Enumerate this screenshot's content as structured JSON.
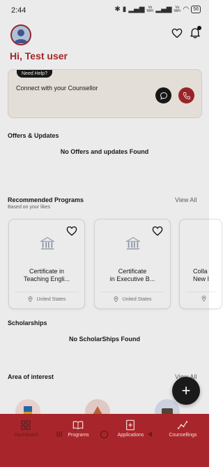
{
  "status_bar": {
    "time": "2:44",
    "battery": "56"
  },
  "header": {
    "greeting": "Hi, Test user"
  },
  "help_card": {
    "badge": "Need Help?",
    "text": "Connect with your Counsellor"
  },
  "offers": {
    "title": "Offers & Updates",
    "empty": "No Offers and updates Found"
  },
  "recommended": {
    "title": "Recommended Programs",
    "subtitle": "Based on your likes",
    "view_all": "View All",
    "cards": [
      {
        "name": "Certificate in Teaching Engli...",
        "line1": "Certificate in",
        "line2": "Teaching Engli...",
        "location": "United States"
      },
      {
        "name": "Certificate in Executive B...",
        "line1": "Certificate",
        "line2": "in Executive B...",
        "location": "United States"
      },
      {
        "line1": "Colla",
        "line2": "New I"
      }
    ]
  },
  "scholarships": {
    "title": "Scholarships",
    "empty": "No ScholarShips Found"
  },
  "area_of_interest": {
    "title": "Area of interest",
    "view_all": "View All"
  },
  "fab": {
    "label": "+"
  },
  "bottom_nav": {
    "items": [
      {
        "label": "Dashboard",
        "icon": "dashboard-icon",
        "active": true
      },
      {
        "label": "Programs",
        "icon": "book-icon",
        "active": false
      },
      {
        "label": "Applications",
        "icon": "applications-icon",
        "active": false
      },
      {
        "label": "Counsellings",
        "icon": "counselling-icon",
        "active": false
      }
    ]
  },
  "colors": {
    "brand": "#a8262b",
    "dark": "#1a1a1a",
    "help_bg": "#f7f1ea"
  }
}
